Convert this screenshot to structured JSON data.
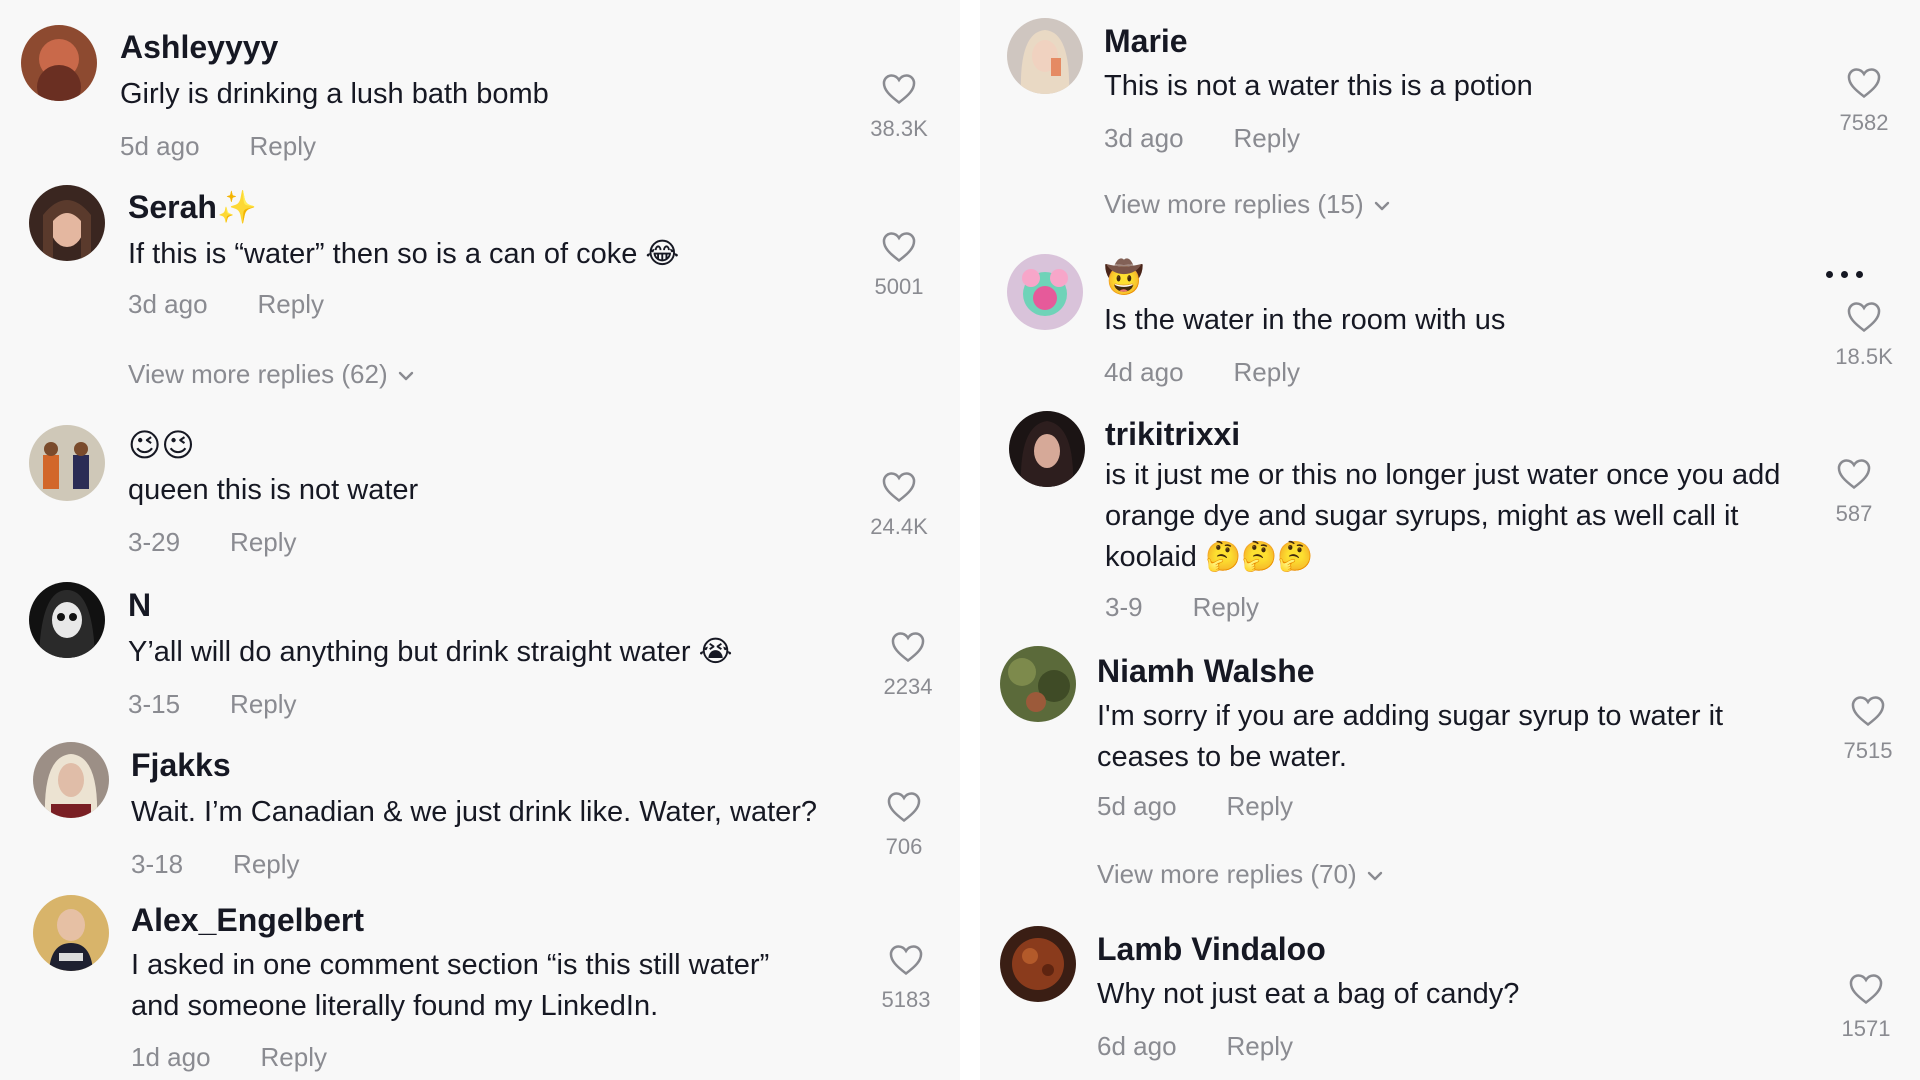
{
  "left": [
    {
      "user": "Ashleyyyy",
      "text": [
        "Girly is drinking a lush bath bomb"
      ],
      "time": "5d ago",
      "reply": "Reply",
      "likes": "38.3K"
    },
    {
      "user": "Serah✨",
      "text": [
        "If this is “water” then so is a can of coke 😂"
      ],
      "time": "3d ago",
      "reply": "Reply",
      "likes": "5001",
      "more_replies": "View more replies (62)"
    },
    {
      "user": "😉😉",
      "text": [
        "queen this is not water"
      ],
      "time": "3-29",
      "reply": "Reply",
      "likes": "24.4K"
    },
    {
      "user": "N",
      "text": [
        "Y’all will do anything but drink straight water 😭"
      ],
      "time": "3-15",
      "reply": "Reply",
      "likes": "2234"
    },
    {
      "user": "Fjakks",
      "text": [
        "Wait. I’m Canadian & we just drink like. Water, water?"
      ],
      "time": "3-18",
      "reply": "Reply",
      "likes": "706"
    },
    {
      "user": "Alex_Engelbert",
      "text": [
        "I asked in one comment section “is this still water”",
        "and someone literally found my LinkedIn."
      ],
      "time": "1d ago",
      "reply": "Reply",
      "likes": "5183"
    }
  ],
  "right": [
    {
      "user": "Marie",
      "text": [
        "This is not a water this is a potion"
      ],
      "time": "3d ago",
      "reply": "Reply",
      "likes": "7582",
      "more_replies": "View more replies (15)"
    },
    {
      "user": "🤠",
      "text": [
        "Is the water in the room with us"
      ],
      "time": "4d ago",
      "reply": "Reply",
      "likes": "18.5K"
    },
    {
      "user": "trikitrixxi",
      "text": [
        "is it just me or this no longer just water once you add",
        "orange dye and sugar syrups, might as well call it",
        "koolaid 🤔🤔🤔"
      ],
      "time": "3-9",
      "reply": "Reply",
      "likes": "587"
    },
    {
      "user": "Niamh Walshe",
      "text": [
        "I'm sorry if you are adding sugar syrup to water it",
        "ceases to be water."
      ],
      "time": "5d ago",
      "reply": "Reply",
      "likes": "7515",
      "more_replies": "View more replies (70)"
    },
    {
      "user": "Lamb Vindaloo",
      "text": [
        "Why not just eat a bag of candy?"
      ],
      "time": "6d ago",
      "reply": "Reply",
      "likes": "1571"
    }
  ],
  "icons": {
    "like": "heart-outline-icon",
    "expand": "chevron-down-icon",
    "more": "more-options-icon"
  },
  "colors": {
    "text": "#161823",
    "muted": "#8a8b91",
    "panel": "#f8f8f8",
    "divider": "#ffffff"
  }
}
